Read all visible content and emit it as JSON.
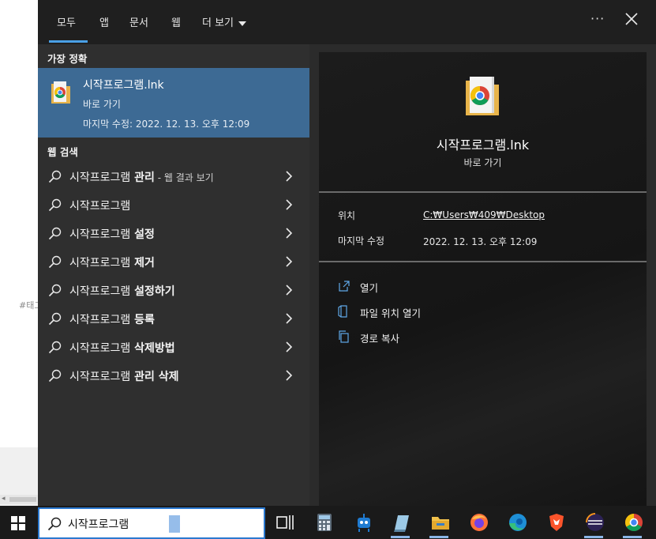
{
  "tabs": [
    "모두",
    "앱",
    "문서",
    "웹",
    "더 보기"
  ],
  "header": {
    "ellipsis": "···"
  },
  "left": {
    "best_match_heading": "가장 정확",
    "best_match": {
      "title": "시작프로그램.lnk",
      "type": "바로 가기",
      "modified": "마지막 수정: 2022. 12. 13. 오후 12:09"
    },
    "web_heading": "웹 검색",
    "web_results": [
      {
        "query": "시작프로그램",
        "bold": " 관리",
        "suffix": " - 웹 결과 보기"
      },
      {
        "query": "시작프로그램",
        "bold": "",
        "suffix": ""
      },
      {
        "query": "시작프로그램",
        "bold": " 설정",
        "suffix": ""
      },
      {
        "query": "시작프로그램",
        "bold": " 제거",
        "suffix": ""
      },
      {
        "query": "시작프로그램",
        "bold": " 설정하기",
        "suffix": ""
      },
      {
        "query": "시작프로그램",
        "bold": " 등록",
        "suffix": ""
      },
      {
        "query": "시작프로그램",
        "bold": " 삭제방법",
        "suffix": ""
      },
      {
        "query": "시작프로그램",
        "bold": " 관리 삭제",
        "suffix": ""
      }
    ]
  },
  "right": {
    "title": "시작프로그램.lnk",
    "subtitle": "바로 가기",
    "location_label": "위치",
    "location_value": "C:₩Users₩409₩Desktop",
    "modified_label": "마지막 수정",
    "modified_value": "2022. 12. 13. 오후 12:09",
    "actions": [
      "열기",
      "파일 위치 열기",
      "경로 복사"
    ]
  },
  "background": {
    "tag_text": "#태그"
  },
  "taskbar": {
    "search_value": "시작프로그램",
    "icons": [
      "task-view-icon",
      "calculator-icon",
      "robot-app-icon",
      "notepad-icon",
      "file-explorer-icon",
      "firefox-icon",
      "edge-icon",
      "brave-icon",
      "eclipse-icon",
      "chrome-icon"
    ]
  },
  "colors": {
    "accent": "#4aa0e6",
    "selected": "#3d6a94",
    "search_border": "#2b79d0"
  }
}
